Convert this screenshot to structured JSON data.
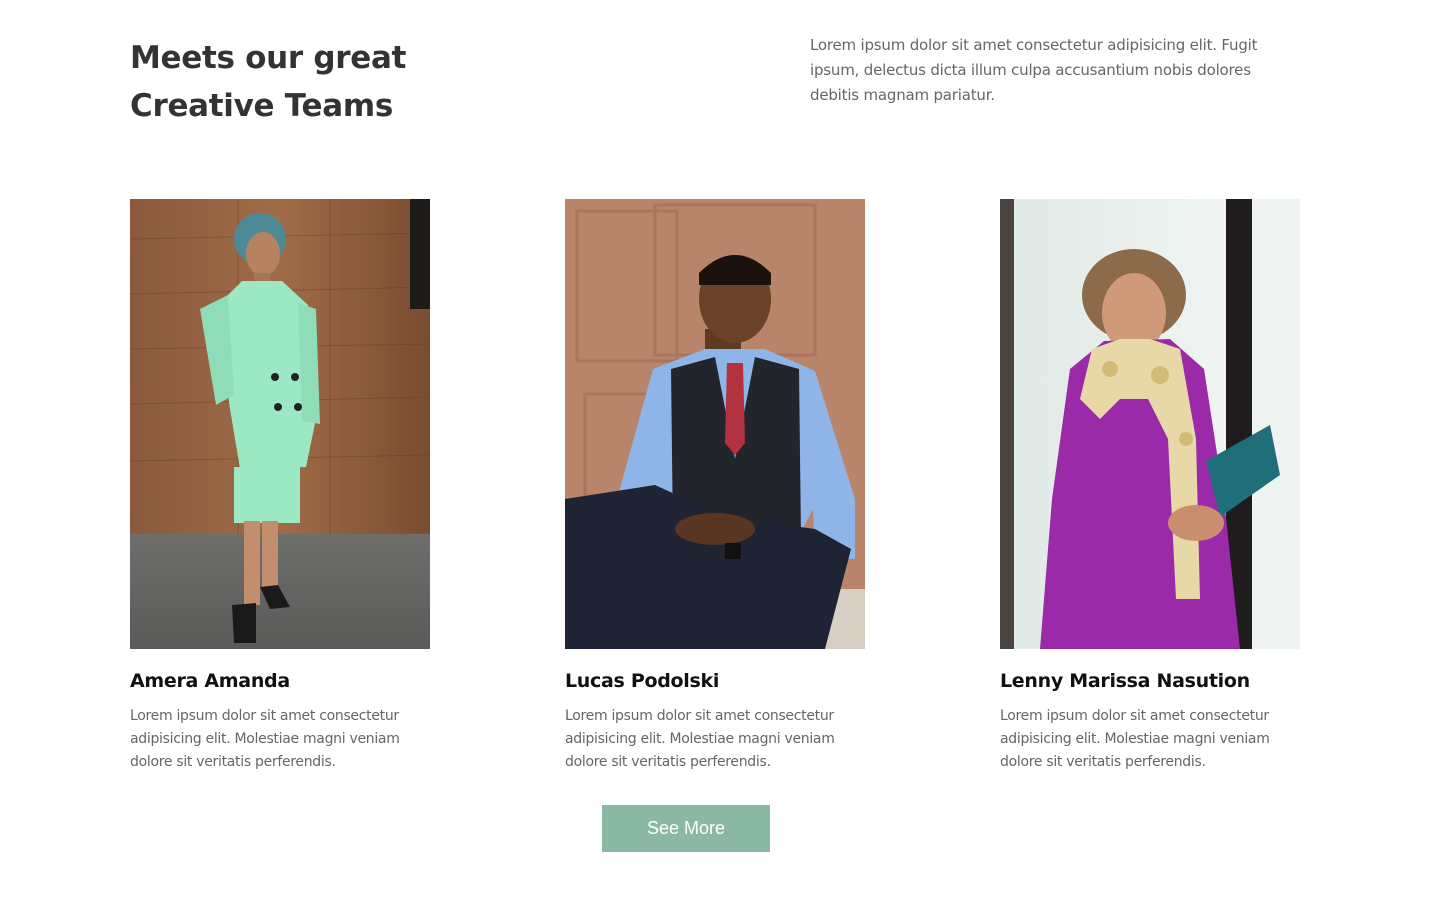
{
  "section": {
    "heading_line1": "Meets our great",
    "heading_line2": "Creative Teams",
    "intro": "Lorem ipsum dolor sit amet consectetur adipisicing elit. Fugit ipsum, delectus dicta illum culpa accusantium nobis dolores debitis magnam pariatur."
  },
  "team": [
    {
      "name": "Amera Amanda",
      "bio": "Lorem ipsum dolor sit amet consectetur adipisicing elit. Molestiae magni veniam dolore sit veritatis perferendis."
    },
    {
      "name": "Lucas Podolski",
      "bio": "Lorem ipsum dolor sit amet consectetur adipisicing elit. Molestiae magni veniam dolore sit veritatis perferendis."
    },
    {
      "name": "Lenny Marissa Nasution",
      "bio": "Lorem ipsum dolor sit amet consectetur adipisicing elit. Molestiae magni veniam dolore sit veritatis perferendis."
    }
  ],
  "cta": {
    "label": "See More"
  },
  "colors": {
    "button_bg": "#8bb8a2",
    "heading": "#333333",
    "body_text": "#666666"
  }
}
